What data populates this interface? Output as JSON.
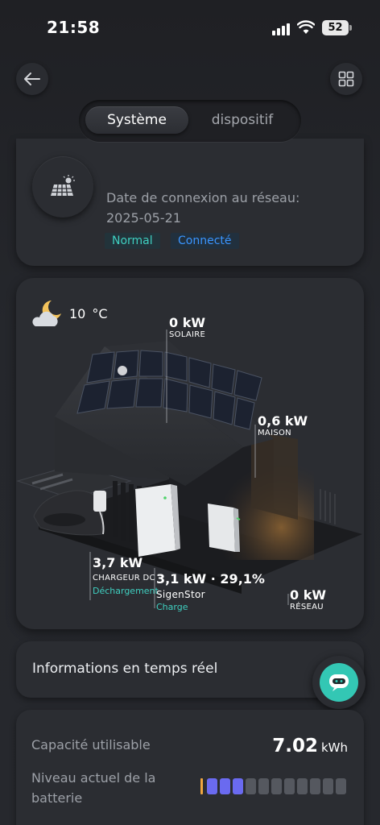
{
  "status_bar": {
    "time": "21:58",
    "battery": "52"
  },
  "tabs": [
    {
      "label": "Système",
      "active": true
    },
    {
      "label": "dispositif",
      "active": false
    }
  ],
  "device": {
    "connection_label": "Date de connexion au réseau:",
    "connection_date": "2025-05-21",
    "status_badge": "Normal",
    "connection_badge": "Connecté"
  },
  "scene": {
    "weather": {
      "temp": "10",
      "unit": "°C"
    },
    "solar": {
      "value": "0 kW",
      "label": "SOLAIRE"
    },
    "home": {
      "value": "0,6 kW",
      "label": "MAISON"
    },
    "charger": {
      "value": "3,7 kW",
      "label": "CHARGEUR DC",
      "status": "Déchargement"
    },
    "storage": {
      "value": "3,1 kW · 29,1%",
      "label": "SigenStor",
      "status": "Charge"
    },
    "grid": {
      "value": "0 kW",
      "label": "RÉSEAU"
    }
  },
  "realtime": {
    "title": "Informations en temps réel"
  },
  "battery": {
    "capacity_label": "Capacité utilisable",
    "capacity_value": "7.02",
    "capacity_unit": "kWh",
    "level_label": "Niveau actuel de la batterie",
    "segments_total": 11,
    "segments_filled": 3
  },
  "colors": {
    "accent_teal": "#3fcfc0",
    "accent_blue": "#3a95ff",
    "level_fill": "#6a6af0",
    "assistant": "#33c7b4"
  }
}
